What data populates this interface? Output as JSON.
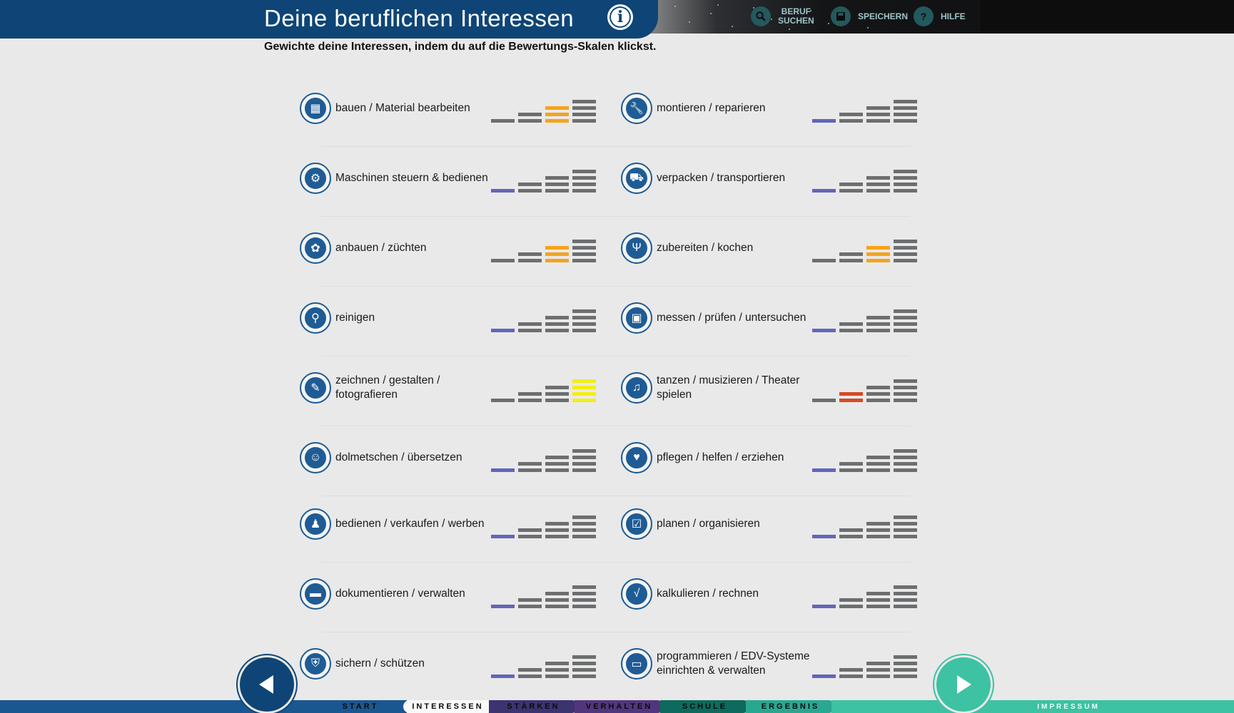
{
  "header": {
    "title": "Deine beruflichen Interessen",
    "info_icon": "info-icon",
    "actions": [
      {
        "name": "search-job",
        "label_line1": "BERUF",
        "label_line2": "SUCHEN",
        "icon": "search-icon"
      },
      {
        "name": "save",
        "label_line1": "SPEICHERN",
        "label_line2": "",
        "icon": "save-icon"
      },
      {
        "name": "help",
        "label_line1": "HILFE",
        "label_line2": "",
        "icon": "help-icon"
      }
    ]
  },
  "subtitle": "Gewichte deine Interessen, indem du auf die Bewertungs-Skalen klickst.",
  "colors": {
    "brand": "#0e4576",
    "bar_default": "#6d6e70",
    "level1": "#6166b8",
    "level2": "#d64a24",
    "level3": "#f5a31c",
    "level4": "#f3ef14"
  },
  "interests": [
    {
      "label": "bauen / Material bearbeiten",
      "icon": "bricks-icon",
      "rating": 3
    },
    {
      "label": "montieren / reparieren",
      "icon": "wrench-icon",
      "rating": 1
    },
    {
      "label": "Maschinen steuern & bedienen",
      "icon": "gear-icon",
      "rating": 1
    },
    {
      "label": "verpacken / transportieren",
      "icon": "truck-icon",
      "rating": 1
    },
    {
      "label": "anbauen / züchten",
      "icon": "flower-icon",
      "rating": 3
    },
    {
      "label": "zubereiten / kochen",
      "icon": "cutlery-icon",
      "rating": 3
    },
    {
      "label": "reinigen",
      "icon": "vacuum-icon",
      "rating": 1
    },
    {
      "label": "messen / prüfen / untersuchen",
      "icon": "meter-icon",
      "rating": 1
    },
    {
      "label": "zeichnen / gestalten / fotografieren",
      "icon": "drawing-icon",
      "rating": 4
    },
    {
      "label": "tanzen / musizieren / Theater spielen",
      "icon": "music-note-icon",
      "rating": 2
    },
    {
      "label": "dolmetschen / übersetzen",
      "icon": "speech-person-icon",
      "rating": 1
    },
    {
      "label": "pflegen / helfen / erziehen",
      "icon": "heart-plus-icon",
      "rating": 1
    },
    {
      "label": "bedienen / verkaufen / werben",
      "icon": "person-tie-icon",
      "rating": 1
    },
    {
      "label": "planen / organisieren",
      "icon": "checklist-icon",
      "rating": 1
    },
    {
      "label": "dokumentieren / verwalten",
      "icon": "folder-icon",
      "rating": 1
    },
    {
      "label": "kalkulieren / rechnen",
      "icon": "sqrt-icon",
      "rating": 1
    },
    {
      "label": "sichern / schützen",
      "icon": "shield-icon",
      "rating": 1
    },
    {
      "label": "programmieren / EDV-Systeme einrichten & verwalten",
      "icon": "monitor-icon",
      "rating": 1
    }
  ],
  "footer": {
    "tabs": [
      "START",
      "INTERESSEN",
      "STÄRKEN",
      "VERHALTEN",
      "SCHULE",
      "ERGEBNIS"
    ],
    "active_tab": "INTERESSEN",
    "impressum": "IMPRESSUM",
    "back_icon": "arrow-left-icon",
    "next_icon": "arrow-right-icon"
  }
}
